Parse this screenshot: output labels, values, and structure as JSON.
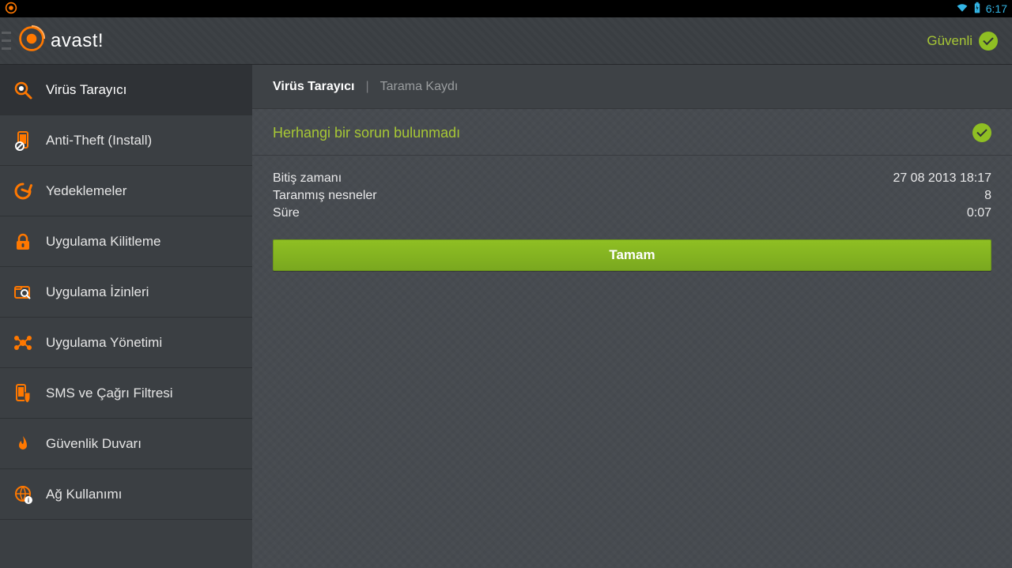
{
  "statusbar": {
    "time": "6:17"
  },
  "header": {
    "app_name": "avast!",
    "safe_label": "Güvenli"
  },
  "sidebar": {
    "items": [
      {
        "label": "Virüs Tarayıcı"
      },
      {
        "label": "Anti-Theft (Install)"
      },
      {
        "label": "Yedeklemeler"
      },
      {
        "label": "Uygulama Kilitleme"
      },
      {
        "label": "Uygulama İzinleri"
      },
      {
        "label": "Uygulama Yönetimi"
      },
      {
        "label": "SMS ve Çağrı Filtresi"
      },
      {
        "label": "Güvenlik Duvarı"
      },
      {
        "label": "Ağ Kullanımı"
      }
    ]
  },
  "breadcrumb": {
    "first": "Virüs Tarayıcı",
    "sep": "|",
    "second": "Tarama Kaydı"
  },
  "result": {
    "message": "Herhangi bir sorun bulunmadı"
  },
  "details": {
    "rows": [
      {
        "label": "Bitiş zamanı",
        "value": "27 08 2013 18:17"
      },
      {
        "label": "Taranmış nesneler",
        "value": "8"
      },
      {
        "label": "Süre",
        "value": "0:07"
      }
    ]
  },
  "buttons": {
    "ok": "Tamam"
  },
  "colors": {
    "accent": "#8fbf23",
    "accent_text": "#a7c735",
    "brand_orange": "#ff7800",
    "status_blue": "#33b5e5"
  }
}
